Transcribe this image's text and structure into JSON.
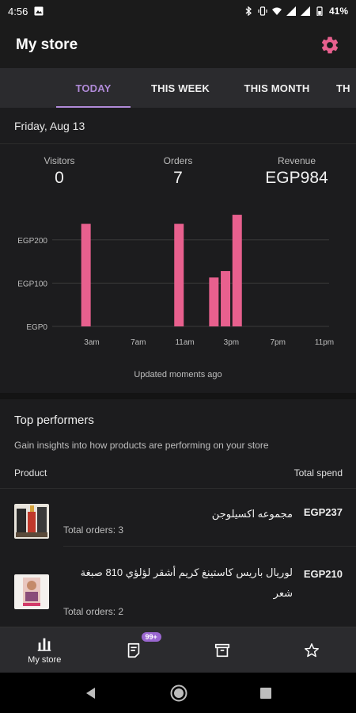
{
  "status": {
    "time": "4:56",
    "battery": "41%"
  },
  "app": {
    "title": "My store"
  },
  "tabs": [
    "TODAY",
    "THIS WEEK",
    "THIS MONTH",
    "TH"
  ],
  "date": "Friday, Aug 13",
  "stats": {
    "visitors_label": "Visitors",
    "visitors_value": "0",
    "orders_label": "Orders",
    "orders_value": "7",
    "revenue_label": "Revenue",
    "revenue_value": "EGP984"
  },
  "chart_data": {
    "type": "bar",
    "x_tick_labels": [
      "3am",
      "7am",
      "11am",
      "3pm",
      "7pm",
      "11pm"
    ],
    "y_tick_labels": [
      "EGP0",
      "EGP100",
      "EGP200"
    ],
    "ylim": [
      0,
      260
    ],
    "grid": true,
    "points": [
      {
        "hour": 2,
        "value": 237
      },
      {
        "hour": 10,
        "value": 237
      },
      {
        "hour": 13,
        "value": 113
      },
      {
        "hour": 14,
        "value": 128
      },
      {
        "hour": 15,
        "value": 258
      }
    ]
  },
  "updated_text": "Updated moments ago",
  "top": {
    "title": "Top performers",
    "subtitle": "Gain insights into how products are performing on your store",
    "col_product": "Product",
    "col_spend": "Total spend",
    "items": [
      {
        "name": "مجموعه اكسيلوجن",
        "orders": "Total orders: 3",
        "price": "EGP237"
      },
      {
        "name": "لوريال باريس كاستينغ كريم أشقر لؤلؤي 810 صبغة شعر",
        "orders": "Total orders: 2",
        "price": "EGP210"
      }
    ]
  },
  "bottom_nav": {
    "mystore_label": "My store",
    "badge": "99+"
  },
  "colors": {
    "accent": "#b08ad8",
    "bar": "#e8608e",
    "gear": "#e8608e"
  }
}
